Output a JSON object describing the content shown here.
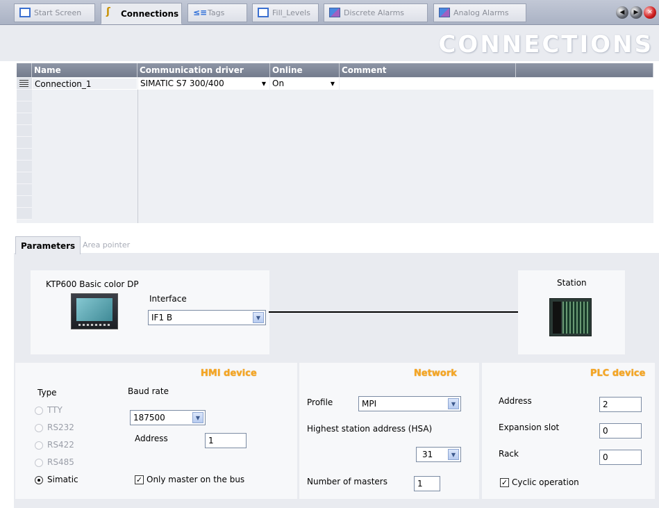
{
  "tabs": [
    {
      "label": "Start Screen",
      "icon": "screen-icon",
      "active": false
    },
    {
      "label": "Connections",
      "icon": "connections-icon",
      "active": true
    },
    {
      "label": "Tags",
      "icon": "tags-icon",
      "active": false
    },
    {
      "label": "Fill_Levels",
      "icon": "screen-icon",
      "active": false
    },
    {
      "label": "Discrete Alarms",
      "icon": "discrete-alarms-icon",
      "active": false
    },
    {
      "label": "Analog Alarms",
      "icon": "analog-alarms-icon",
      "active": false
    }
  ],
  "nav": {
    "back_icon": "back-icon",
    "forward_icon": "forward-icon",
    "close_icon": "close-icon"
  },
  "page_title": "CONNECTIONS",
  "table": {
    "columns": [
      "Name",
      "Communication driver",
      "Online",
      "Comment"
    ],
    "rows": [
      {
        "name": "Connection_1",
        "driver": "SIMATIC S7 300/400",
        "online": "On",
        "comment": ""
      }
    ]
  },
  "lower_tabs": {
    "parameters": "Parameters",
    "area_pointer": "Area pointer"
  },
  "diagram": {
    "device_name": "KTP600 Basic color DP",
    "interface_label": "Interface",
    "interface_value": "IF1 B",
    "station_label": "Station"
  },
  "hmi_device": {
    "title": "HMI device",
    "type_label": "Type",
    "types": [
      "TTY",
      "RS232",
      "RS422",
      "RS485",
      "Simatic"
    ],
    "selected_type": "Simatic",
    "baud_rate_label": "Baud rate",
    "baud_rate": "187500",
    "address_label": "Address",
    "address": "1",
    "only_master_label": "Only master on the bus",
    "only_master_checked": true
  },
  "network": {
    "title": "Network",
    "profile_label": "Profile",
    "profile": "MPI",
    "hsa_label": "Highest station address (HSA)",
    "hsa": "31",
    "masters_label": "Number of masters",
    "masters": "1"
  },
  "plc_device": {
    "title": "PLC device",
    "address_label": "Address",
    "address": "2",
    "slot_label": "Expansion slot",
    "slot": "0",
    "rack_label": "Rack",
    "rack": "0",
    "cyclic_label": "Cyclic operation",
    "cyclic_checked": true
  },
  "colors": {
    "section_title": "#f5a623",
    "header_bg": "#7b8394",
    "panel_bg": "#e9ebf0"
  }
}
